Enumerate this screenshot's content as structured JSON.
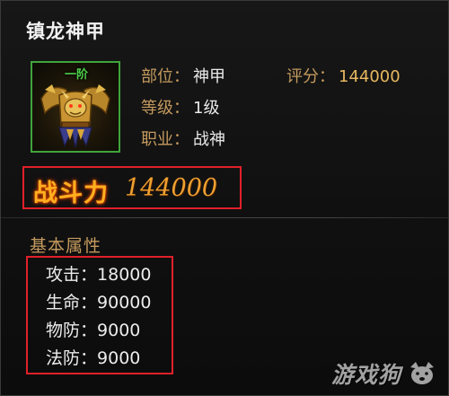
{
  "item": {
    "name": "镇龙神甲",
    "grade_badge": "一阶"
  },
  "info": {
    "slot_label": "部位：",
    "slot_value": "神甲",
    "level_label": "等级：",
    "level_value": "1级",
    "class_label": "职业：",
    "class_value": "战神",
    "score_label": "评分：",
    "score_value": "144000"
  },
  "power": {
    "label": "战斗力",
    "value": "144000"
  },
  "attributes": {
    "title": "基本属性",
    "items": [
      {
        "label": "攻击",
        "value": "18000"
      },
      {
        "label": "生命",
        "value": "90000"
      },
      {
        "label": "物防",
        "value": "9000"
      },
      {
        "label": "法防",
        "value": "9000"
      }
    ]
  },
  "watermark": {
    "text": "游戏狗"
  },
  "colors": {
    "frame_green": "#3fa43b",
    "highlight_red": "#e0202a",
    "label_gold": "#c49a5e",
    "power_orange": "#ffb020"
  }
}
